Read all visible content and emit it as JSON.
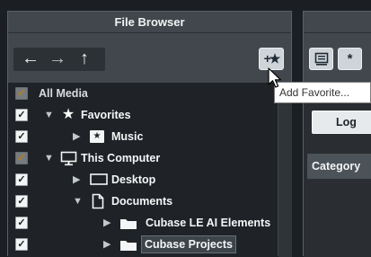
{
  "file_browser": {
    "title": "File Browser",
    "nav": {
      "back_icon": "arrow-left-icon",
      "forward_icon": "arrow-right-icon",
      "up_icon": "arrow-up-icon"
    },
    "add_favorite_icon": "add-favorite-star-icon",
    "tooltip": "Add Favorite..."
  },
  "tree": [
    {
      "label": "All Media",
      "checkbox": "dim-checked",
      "level": 0
    },
    {
      "label": "Favorites",
      "checkbox": "checked",
      "expanded": true,
      "icon": "star-icon",
      "level": 0
    },
    {
      "label": "Music",
      "checkbox": "checked",
      "expanded": false,
      "icon": "star-folder-icon",
      "level": 1
    },
    {
      "label": "This Computer",
      "checkbox": "orange-checked",
      "expanded": true,
      "icon": "monitor-icon",
      "level": 0
    },
    {
      "label": "Desktop",
      "checkbox": "checked",
      "expanded": false,
      "icon": "desktop-icon",
      "level": 1
    },
    {
      "label": "Documents",
      "checkbox": "checked",
      "expanded": true,
      "icon": "document-icon",
      "level": 1
    },
    {
      "label": "Cubase LE AI Elements",
      "checkbox": "checked",
      "expanded": false,
      "icon": "folder-icon",
      "level": 2
    },
    {
      "label": "Cubase Projects",
      "checkbox": "checked",
      "expanded": false,
      "icon": "folder-icon",
      "level": 2,
      "selected": true
    }
  ],
  "right_panel": {
    "button_b": "*",
    "log_button": "Log",
    "category": "Category"
  },
  "colors": {
    "panel": "#41474c",
    "tree_bg": "#1f2327",
    "accent_orange": "#e08d12"
  }
}
